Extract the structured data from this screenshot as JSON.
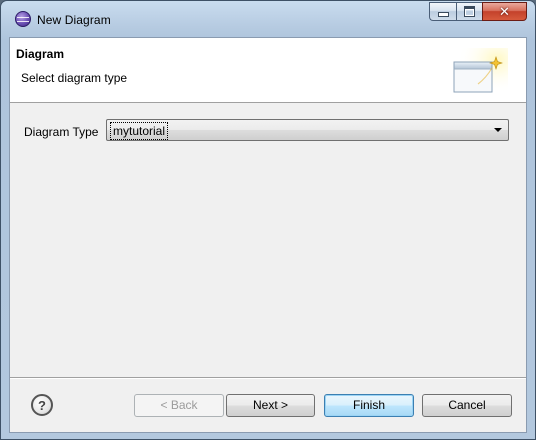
{
  "window": {
    "title": "New Diagram",
    "caption_close_glyph": "✕"
  },
  "header": {
    "title": "Diagram",
    "subtitle": "Select diagram type"
  },
  "form": {
    "diagram_type_label": "Diagram Type",
    "diagram_type_value": "mytutorial"
  },
  "footer": {
    "help_glyph": "?",
    "back_label": "< Back",
    "next_label": "Next >",
    "finish_label": "Finish",
    "cancel_label": "Cancel"
  },
  "icons": {
    "app": "eclipse-icon",
    "wizard_banner": "new-diagram-wizard-icon",
    "help": "help-icon",
    "dropdown": "chevron-down-icon"
  },
  "colors": {
    "default_button_border": "#3c7fb1",
    "close_button": "#c4412b"
  }
}
